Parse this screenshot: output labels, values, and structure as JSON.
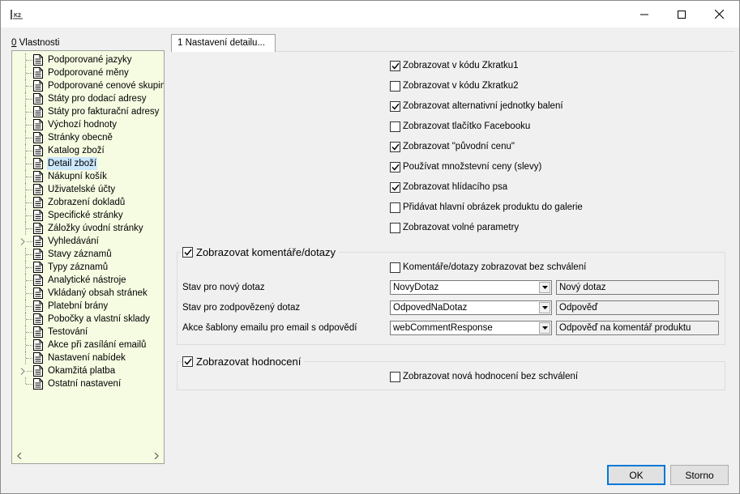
{
  "window": {
    "title": ""
  },
  "left_panel": {
    "label_accel": "0",
    "label_rest": " Vlastnosti",
    "tree_items": [
      {
        "label": "Podporované jazyky",
        "expandable": false
      },
      {
        "label": "Podporované měny",
        "expandable": false
      },
      {
        "label": "Podporované cenové skupiny",
        "expandable": false
      },
      {
        "label": "Státy pro dodací adresy",
        "expandable": false
      },
      {
        "label": "Státy pro fakturační adresy",
        "expandable": false
      },
      {
        "label": "Výchozí hodnoty",
        "expandable": false
      },
      {
        "label": "Stránky obecně",
        "expandable": false
      },
      {
        "label": "Katalog zboží",
        "expandable": false
      },
      {
        "label": "Detail zboží",
        "expandable": false,
        "selected": true
      },
      {
        "label": "Nákupní košík",
        "expandable": false
      },
      {
        "label": "Uživatelské účty",
        "expandable": false
      },
      {
        "label": "Zobrazení dokladů",
        "expandable": false
      },
      {
        "label": "Specifické stránky",
        "expandable": false
      },
      {
        "label": "Záložky úvodní stránky",
        "expandable": false
      },
      {
        "label": "Vyhledávání",
        "expandable": true
      },
      {
        "label": "Stavy záznamů",
        "expandable": false
      },
      {
        "label": "Typy záznamů",
        "expandable": false
      },
      {
        "label": "Analytické nástroje",
        "expandable": false
      },
      {
        "label": "Vkládaný obsah stránek",
        "expandable": false
      },
      {
        "label": "Platební brány",
        "expandable": false
      },
      {
        "label": "Pobočky a vlastní sklady",
        "expandable": false
      },
      {
        "label": "Testování",
        "expandable": false
      },
      {
        "label": "Akce při zasílání emailů",
        "expandable": false
      },
      {
        "label": "Nastavení nabídek",
        "expandable": false
      },
      {
        "label": "Okamžitá platba",
        "expandable": true
      },
      {
        "label": "Ostatní nastavení",
        "expandable": false
      }
    ]
  },
  "tab": {
    "label": "1 Nastavení detailu..."
  },
  "options": [
    {
      "label": "Zobrazovat v kódu Zkratku1",
      "checked": true
    },
    {
      "label": "Zobrazovat v kódu Zkratku2",
      "checked": false
    },
    {
      "label": "Zobrazovat alternativní jednotky balení",
      "checked": true
    },
    {
      "label": "Zobrazovat tlačítko Facebooku",
      "checked": false
    },
    {
      "label": "Zobrazovat \"původní cenu\"",
      "checked": true
    },
    {
      "label": "Používat množstevní ceny (slevy)",
      "checked": true
    },
    {
      "label": "Zobrazovat hlídacího psa",
      "checked": true
    },
    {
      "label": "Přidávat hlavní obrázek produktu do galerie",
      "checked": false
    },
    {
      "label": "Zobrazovat volné parametry",
      "checked": false
    }
  ],
  "comments_group": {
    "title": "Zobrazovat komentáře/dotazy",
    "checked": true,
    "approve_label": "Komentáře/dotazy zobrazovat bez schválení",
    "approve_checked": false,
    "rows": [
      {
        "label": "Stav pro nový dotaz",
        "combo": "NovyDotaz",
        "text": "Nový dotaz"
      },
      {
        "label": "Stav pro zodpovězený dotaz",
        "combo": "OdpovedNaDotaz",
        "text": "Odpověď"
      },
      {
        "label": "Akce šablony emailu pro email s odpovědí",
        "combo": "webCommentResponse",
        "text": "Odpověď na komentář produktu"
      }
    ]
  },
  "ratings_group": {
    "title": "Zobrazovat hodnocení",
    "checked": true,
    "approve_label": "Zobrazovat nová hodnocení bez schválení",
    "approve_checked": false
  },
  "buttons": {
    "ok": "OK",
    "cancel": "Storno"
  }
}
